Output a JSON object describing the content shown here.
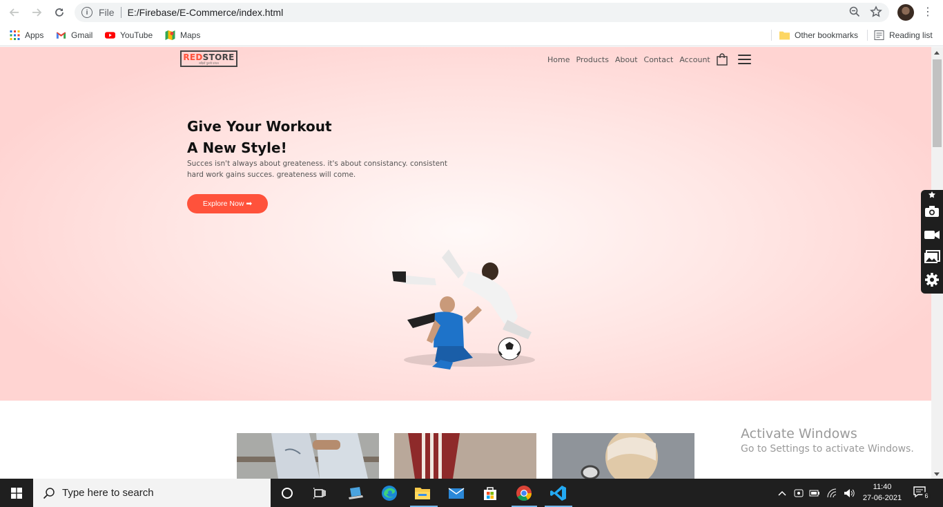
{
  "browser": {
    "scheme_label": "File",
    "url": "E:/Firebase/E-Commerce/index.html",
    "bookmarks": [
      {
        "label": "Apps",
        "icon": "apps-grid-icon"
      },
      {
        "label": "Gmail",
        "icon": "gmail-icon"
      },
      {
        "label": "YouTube",
        "icon": "youtube-icon"
      },
      {
        "label": "Maps",
        "icon": "maps-icon"
      }
    ],
    "other_bookmarks": "Other bookmarks",
    "reading_list": "Reading list"
  },
  "site": {
    "logo_red": "RED",
    "logo_rest": "STORE",
    "logo_tagline": "सदियों पुरानी परंपरा",
    "nav": [
      "Home",
      "Products",
      "About",
      "Contact",
      "Account"
    ],
    "hero_line1": "Give Your Workout",
    "hero_line2": "A New Style!",
    "hero_sub1": "Succes isn't always about greateness. it's about consistancy. consistent",
    "hero_sub2": "hard work gains succes. greateness will come.",
    "cta_label": "Explore Now ➡",
    "accent_color": "#ff523b"
  },
  "watermark": {
    "line1": "Activate Windows",
    "line2": "Go to Settings to activate Windows."
  },
  "taskbar": {
    "search_placeholder": "Type here to search",
    "time": "11:40",
    "date": "27-06-2021",
    "notification_count": "6"
  }
}
